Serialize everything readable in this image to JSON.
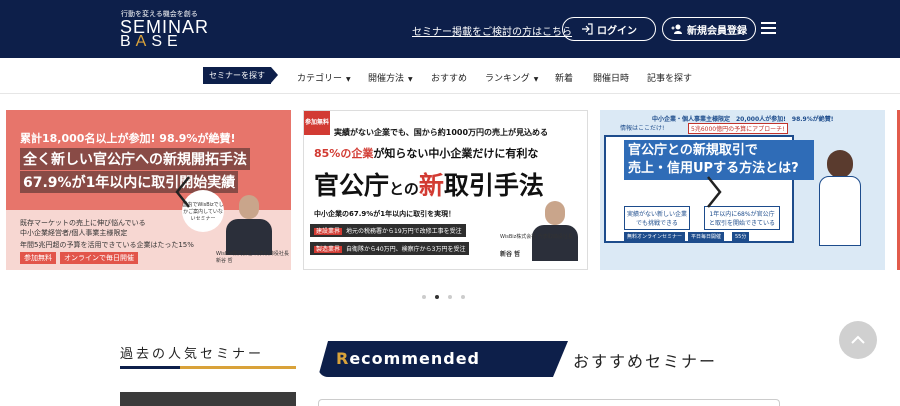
{
  "header": {
    "logo_tag": "行動を変える機会を創る",
    "logo_line1": "SEMINAR",
    "logo_line2_b": "B",
    "logo_line2_a": "A",
    "logo_line2_rest": "SE",
    "link_text": "セミナー掲載をご検討の方はこちら",
    "login_label": "ログイン",
    "register_label": "新規会員登録"
  },
  "nav": {
    "active": "セミナーを探す",
    "items": [
      "カテゴリー",
      "開催方法",
      "おすすめ",
      "ランキング",
      "新着",
      "開催日時",
      "記事を探す"
    ],
    "caret": "▼"
  },
  "carousel": {
    "slide1": {
      "line1": "累計18,000名以上が参加! 98.9%が絶賛!",
      "line2": "全く新しい官公庁への新規開拓手法",
      "line3": "67.9%が1年以内に取引開始実績",
      "desc1": "既存マーケットの売上に伸び悩んでいる",
      "desc2": "中小企業経営者/個人事業主様限定",
      "desc3": "年間5兆円超の予算を活用できている企業はたった15%",
      "tag1": "参加無料",
      "tag2": "オンラインで毎日開催",
      "bubble": "国内でWisBizでしかご案内していないセミナー",
      "caption": "WisBiz株式会社 代表取締役社長 新谷 哲"
    },
    "slide2": {
      "badge": "参加無料",
      "line1": "実績がない企業でも、国から約1000万円の売上が見込める",
      "line2_red": "85%の企業",
      "line2_rest": "が知らない中小企業だけに有利な",
      "line3_a": "官公庁",
      "line3_b": "との",
      "line3_red": "新",
      "line3_c": "取引手法",
      "line4": "中小企業の67.9%が1年以内に取引を実現！",
      "row1_label": "建設業界",
      "row1": "地元の税務署から19万円で改修工事を受注",
      "row2_label": "製造業界",
      "row2": "自衛隊から40万円、検察庁から3万円を受注",
      "cap": "WisBiz株式会社 代表取締役社長",
      "name": "新谷 哲"
    },
    "slide3": {
      "top": "中小企業・個人事業主様限定　20,000人が参加!　98.9%が絶賛!",
      "info": "情報はここだけ!",
      "info_b": "5兆6000億円の予算にアプローチ!",
      "big1": "官公庁との新規取引で",
      "big2": "売上・信用UPする方法とは?",
      "box1": "実績がない新しい企業でも挑戦できる",
      "box2": "1年以内に68%が官公庁と取引を開始できている",
      "b1": "無料オンラインセミナー",
      "b2": "平日毎日開催",
      "b3": "55分"
    },
    "dots": [
      false,
      true,
      false,
      false
    ]
  },
  "past_section": {
    "title": "過去の人気セミナー"
  },
  "recommended": {
    "first_letter": "R",
    "rest": "ecommended",
    "jp": "おすすめセミナー"
  },
  "colors": {
    "navy": "#0d1f4a",
    "gold": "#d9a23a",
    "red": "#d23b33"
  }
}
